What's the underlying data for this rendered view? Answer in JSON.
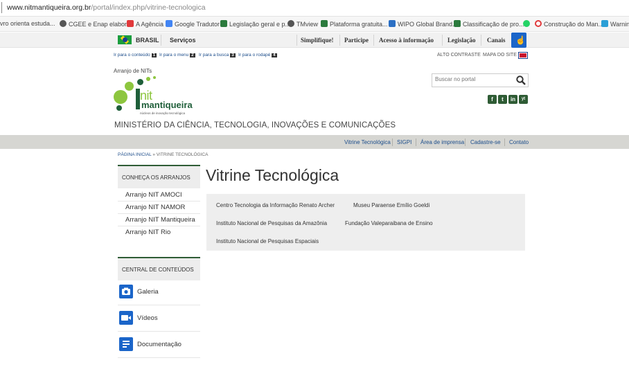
{
  "browser": {
    "url_domain": "www.nitmantiqueira.org.br",
    "url_path": "/portal/index.php/vitrine-tecnologica",
    "bookmarks": [
      {
        "label": "ivro orienta estuda...",
        "color": "#ffffff"
      },
      {
        "label": "CGEE e Enap elabor...",
        "color": "#555555"
      },
      {
        "label": "A Agência",
        "color": "#e1393b"
      },
      {
        "label": "Google Tradutor",
        "color": "#4285f4"
      },
      {
        "label": "Legislação geral e p...",
        "color": "#2b7a3d"
      },
      {
        "label": "TMview",
        "color": "#555555"
      },
      {
        "label": "Plataforma gratuita...",
        "color": "#2b7a3d"
      },
      {
        "label": "WIPO Global Brand...",
        "color": "#2b6fc4"
      },
      {
        "label": "Classificação de pro...",
        "color": "#2b7a3d"
      },
      {
        "label": "",
        "color": "#25d366"
      },
      {
        "label": "Construção do Man...",
        "color": "#e1393b"
      },
      {
        "label": "Warning",
        "color": "#2b9fd6"
      }
    ]
  },
  "gov_bar": {
    "brasil": "BRASIL",
    "servicos": "Serviços",
    "links": [
      "Simplifique!",
      "Participe",
      "Acesso à informação",
      "Legislação",
      "Canais"
    ],
    "accessibility_icon": "hand-icon"
  },
  "header": {
    "skip_links": [
      {
        "label": "Ir para o conteúdo",
        "key": "1"
      },
      {
        "label": "Ir para o menu",
        "key": "2"
      },
      {
        "label": "Ir para a busca",
        "key": "3"
      },
      {
        "label": "Ir para o rodapé",
        "key": "4"
      }
    ],
    "alto_contraste": "ALTO CONTRASTE",
    "mapa_do_site": "MAPA DO SITE",
    "arranjo": "Arranjo de NITs",
    "logo_nit": "nit",
    "logo_name": "mantiqueira",
    "logo_sub": "núcleos de inovação tecnológica",
    "ministry": "MINISTÉRIO DA CIÊNCIA, TECNOLOGIA, INOVAÇÕES E COMUNICAÇÕES",
    "search_placeholder": "Buscar no portal",
    "social": [
      "f",
      "t",
      "in",
      "yt"
    ]
  },
  "nav": [
    "Vitrine Tecnológica",
    "SIGPI",
    "Área de imprensa",
    "Cadastre-se",
    "Contato"
  ],
  "breadcrumb": {
    "home": "PÁGINA INICIAL",
    "sep": "»",
    "current": "VITRINE TECNOLÓGICA"
  },
  "sidebar": {
    "arranjos_title": "CONHEÇA OS ARRANJOS",
    "arranjos": [
      "Arranjo NIT AMOCI",
      "Arranjo NIT NAMOR",
      "Arranjo NIT Mantiqueira",
      "Arranjo NIT Rio"
    ],
    "central_title": "CENTRAL DE CONTEÚDOS",
    "central": [
      {
        "label": "Galeria",
        "icon": "camera-icon"
      },
      {
        "label": "Vídeos",
        "icon": "video-icon"
      },
      {
        "label": "Documentação",
        "icon": "document-icon"
      }
    ]
  },
  "main": {
    "title": "Vitrine Tecnológica",
    "links": [
      "Centro Tecnologia da Informação Renato Archer",
      "Museu Paraense Emílio Goeldi",
      "Instituto Nacional de Pesquisas da Amazônia",
      "Fundação Valeparaibana de Ensino",
      "Instituto Nacional de Pesquisas Espaciais"
    ]
  },
  "colors": {
    "accent_green": "#2f5c35",
    "logo_green": "#8dc63f",
    "link_blue": "#1b4c8a",
    "icon_blue": "#1b65c9"
  }
}
